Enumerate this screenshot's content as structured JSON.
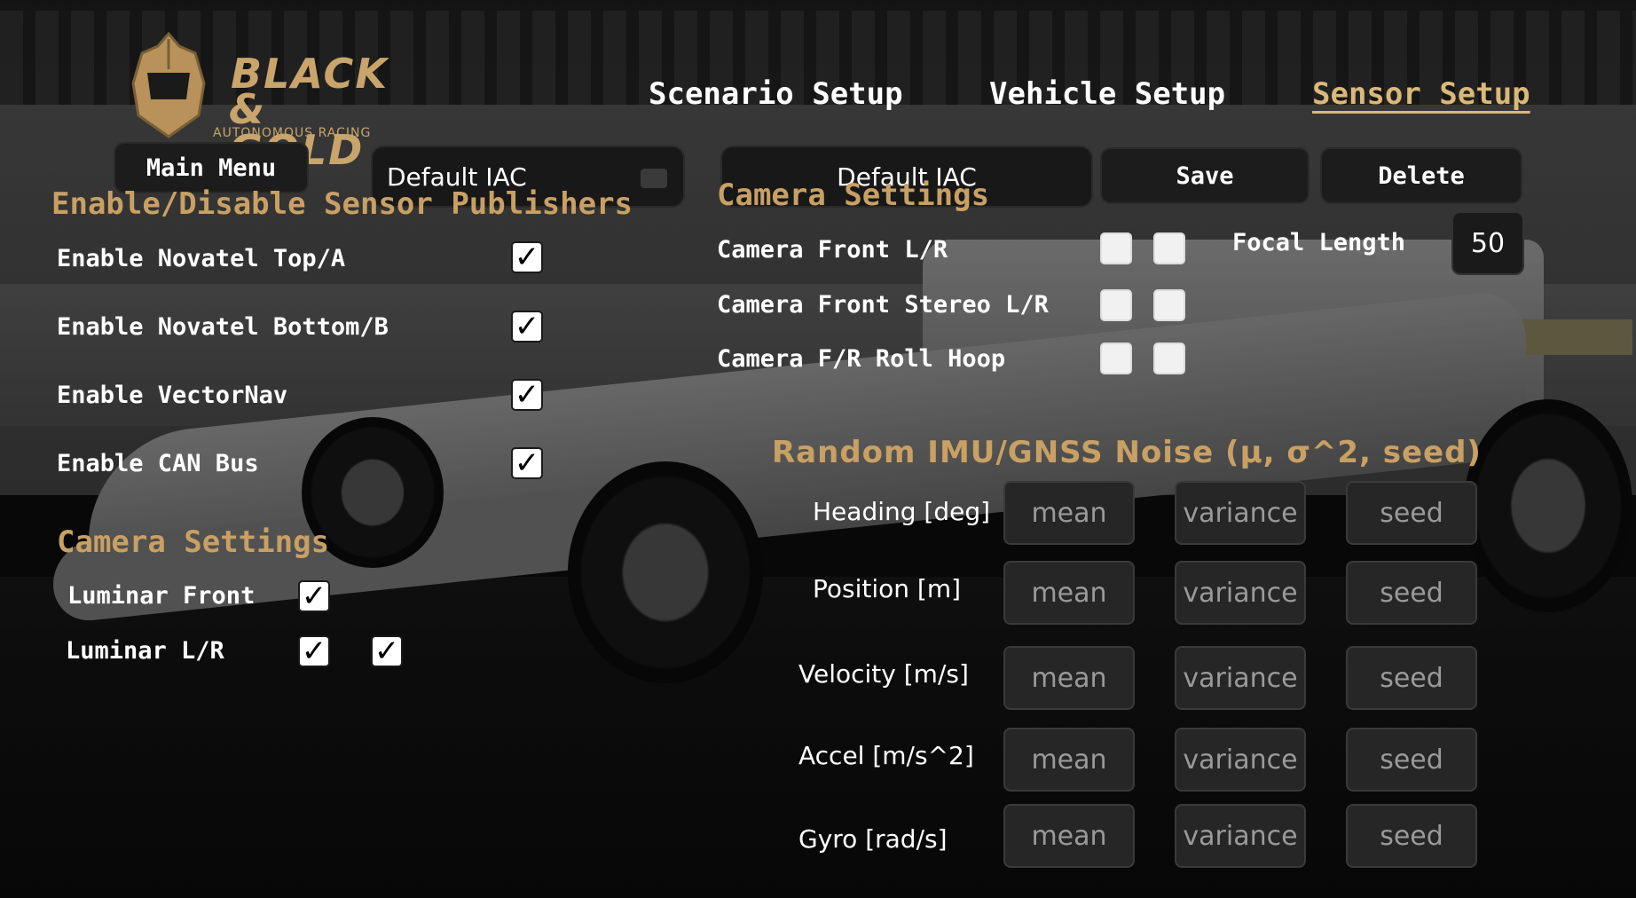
{
  "brand": {
    "line1": "BLACK",
    "line2": "& GOLD",
    "line3": "AUTONOMOUS RACING",
    "gold": "#c9a46b"
  },
  "nav": {
    "scenario": "Scenario Setup",
    "vehicle": "Vehicle Setup",
    "sensor": "Sensor Setup",
    "active": "sensor"
  },
  "toolbar": {
    "main_menu": "Main Menu",
    "preset_left": "Default IAC",
    "preset_right": "Default IAC",
    "save": "Save",
    "delete": "Delete"
  },
  "publishers": {
    "title": "Enable/Disable Sensor Publishers",
    "items": [
      {
        "label": "Enable Novatel Top/A",
        "checked": true
      },
      {
        "label": "Enable Novatel Bottom/B",
        "checked": true
      },
      {
        "label": "Enable VectorNav",
        "checked": true
      },
      {
        "label": "Enable CAN Bus",
        "checked": true
      }
    ]
  },
  "lidar": {
    "title": "Camera Settings",
    "items": [
      {
        "label": "Luminar Front",
        "checks": [
          true
        ]
      },
      {
        "label": "Luminar L/R",
        "checks": [
          true,
          true
        ]
      }
    ]
  },
  "camera": {
    "title": "Camera Settings",
    "items": [
      {
        "label": "Camera Front L/R",
        "checks": [
          false,
          false
        ]
      },
      {
        "label": "Camera Front Stereo L/R",
        "checks": [
          false,
          false
        ]
      },
      {
        "label": "Camera F/R Roll Hoop",
        "checks": [
          false,
          false
        ]
      }
    ],
    "focal_label": "Focal Length",
    "focal_value": "50"
  },
  "noise": {
    "title": "Random IMU/GNSS Noise (μ, σ^2, seed)",
    "placeholders": {
      "mean": "mean",
      "variance": "variance",
      "seed": "seed"
    },
    "rows": [
      {
        "label": "Heading [deg]"
      },
      {
        "label": "Position [m]"
      },
      {
        "label": "Velocity [m/s]"
      },
      {
        "label": "Accel [m/s^2]"
      },
      {
        "label": "Gyro [rad/s]"
      }
    ]
  }
}
